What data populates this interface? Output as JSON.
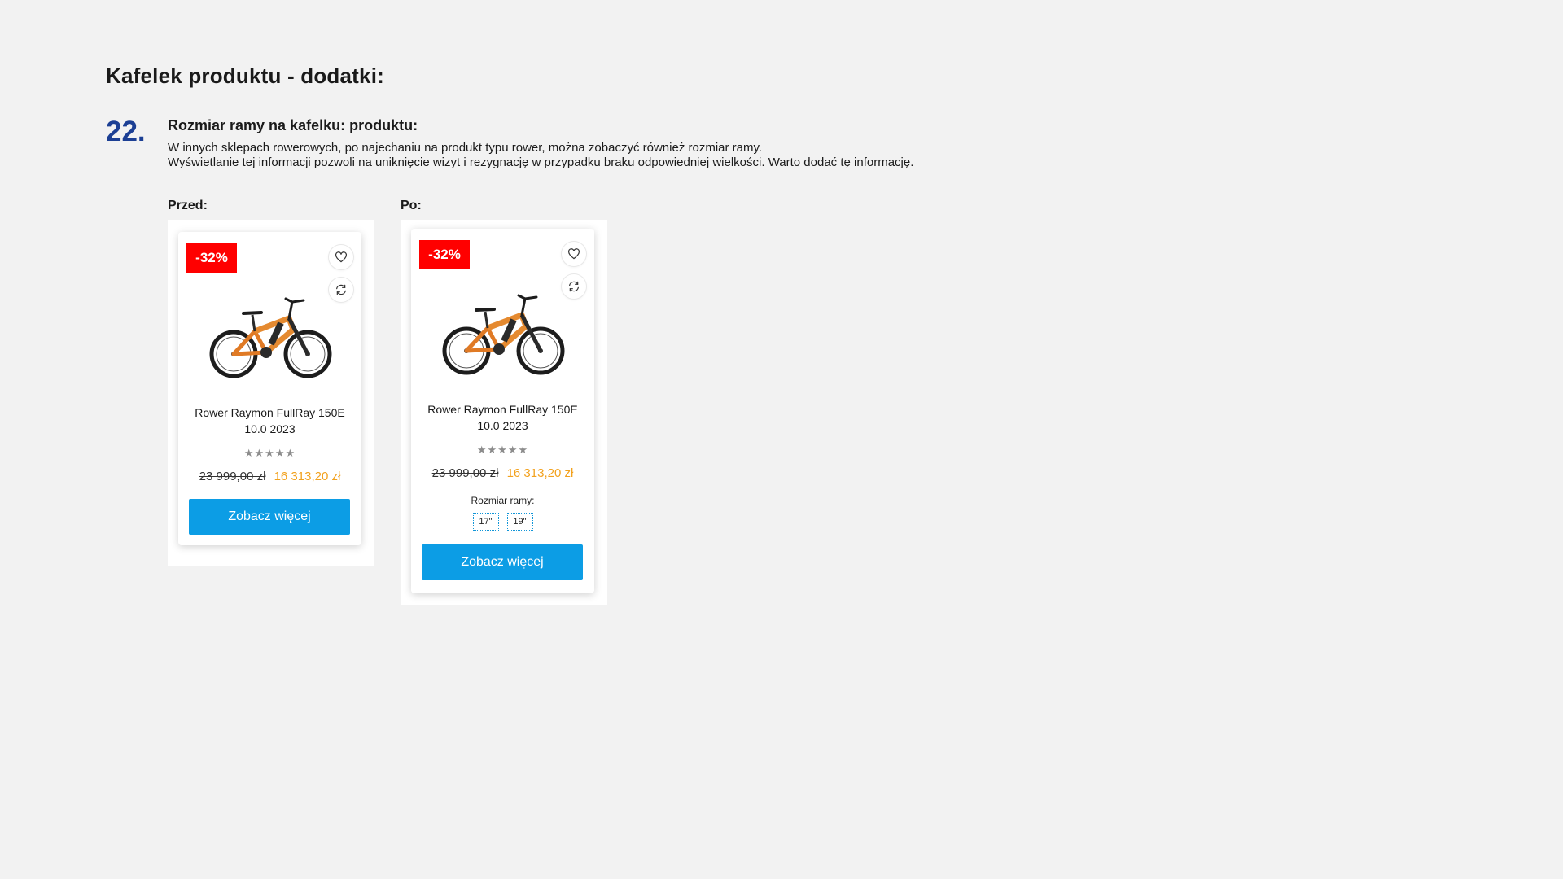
{
  "page": {
    "title": "Kafelek produktu - dodatki:"
  },
  "section": {
    "number": "22.",
    "heading": "Rozmiar ramy na kafelku: produktu:",
    "description_line1": "W innych sklepach rowerowych, po najechaniu na produkt typu rower, można zobaczyć również rozmiar ramy.",
    "description_line2": "Wyświetlanie tej informacji pozwoli na uniknięcie wizyt i rezygnację w przypadku braku odpowiedniej wielkości. Warto dodać tę informację."
  },
  "before": {
    "label": "Przed:",
    "card": {
      "discount": "-32%",
      "name": "Rower Raymon FullRay 150E 10.0 2023",
      "rating_stars": "★★★★★",
      "price_old": "23 999,00 zł",
      "price_new": "16 313,20 zł",
      "cta_label": "Zobacz więcej"
    }
  },
  "after": {
    "label": "Po:",
    "card": {
      "discount": "-32%",
      "name": "Rower Raymon FullRay 150E 10.0 2023",
      "rating_stars": "★★★★★",
      "price_old": "23 999,00 zł",
      "price_new": "16 313,20 zł",
      "size_label": "Rozmiar ramy:",
      "sizes": [
        "17\"",
        "19\""
      ],
      "cta_label": "Zobacz więcej"
    }
  },
  "icons": {
    "wishlist": "heart-icon",
    "compare": "refresh-icon"
  },
  "colors": {
    "accent_blue": "#0c9de5",
    "section_number": "#1c3f94",
    "discount_red": "#ff0000",
    "sale_price": "#f2a11d"
  }
}
